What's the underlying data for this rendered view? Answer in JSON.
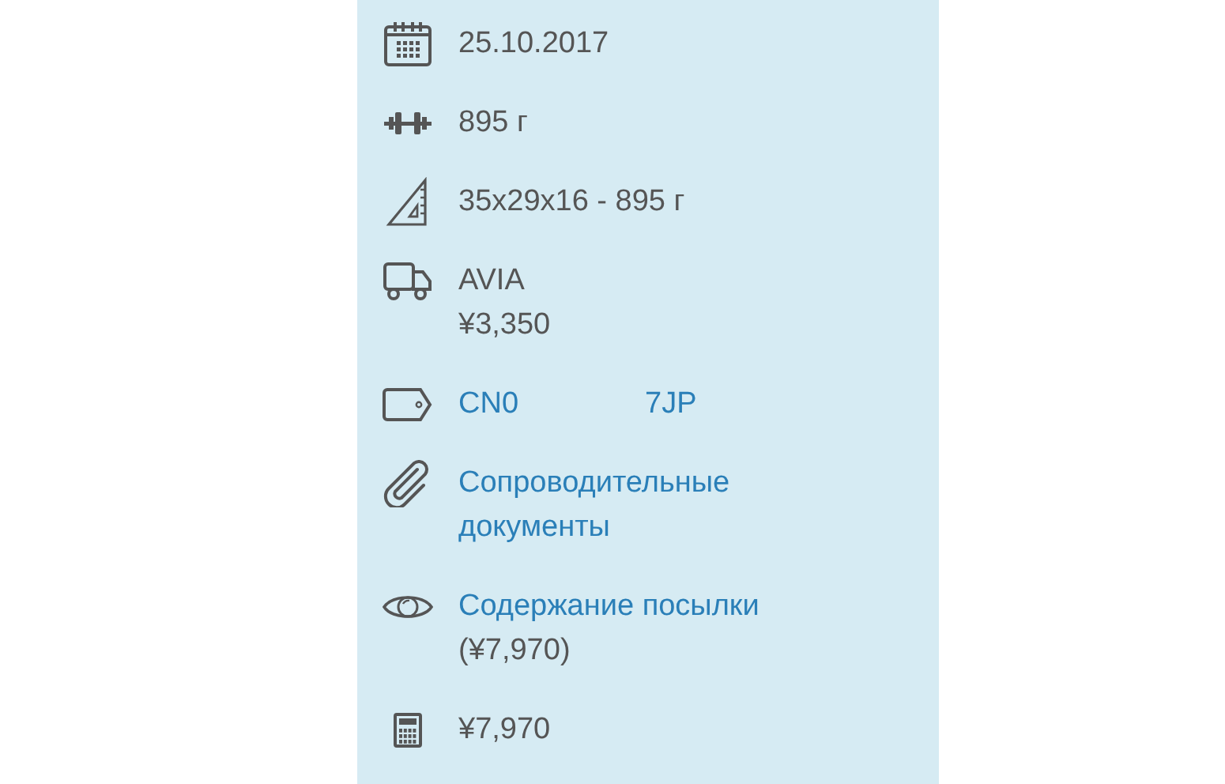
{
  "rows": [
    {
      "kind": "calendar",
      "lines": [
        [
          {
            "text": "25.10.2017",
            "link": false
          }
        ]
      ]
    },
    {
      "kind": "dumbbell",
      "lines": [
        [
          {
            "text": "895 г",
            "link": false
          }
        ]
      ]
    },
    {
      "kind": "ruler",
      "lines": [
        [
          {
            "text": "35x29x16 - 895 г",
            "link": false
          }
        ]
      ]
    },
    {
      "kind": "truck",
      "lines": [
        [
          {
            "text": "AVIA",
            "link": false
          }
        ],
        [
          {
            "text": "¥3,350",
            "link": false
          }
        ]
      ]
    },
    {
      "kind": "tag",
      "lines": [
        [
          {
            "text": "CN0",
            "link": true
          },
          {
            "text": "7JP",
            "link": true
          }
        ]
      ]
    },
    {
      "kind": "paperclip",
      "lines": [
        [
          {
            "text": "Сопроводительные",
            "link": true
          }
        ],
        [
          {
            "text": "документы",
            "link": true
          }
        ]
      ]
    },
    {
      "kind": "eye",
      "lines": [
        [
          {
            "text": "Содержание посылки",
            "link": true
          }
        ],
        [
          {
            "text": "(¥7,970)",
            "link": false
          }
        ]
      ]
    },
    {
      "kind": "calculator",
      "lines": [
        [
          {
            "text": "¥7,970",
            "link": false
          }
        ]
      ]
    }
  ]
}
